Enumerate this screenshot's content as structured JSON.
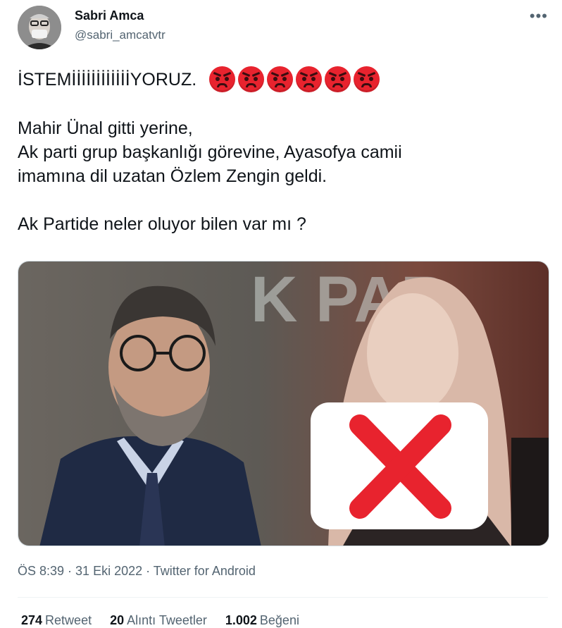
{
  "author": {
    "name": "Sabri Amca",
    "handle": "@sabri_amcatvtr"
  },
  "menu": {
    "icon": "more-icon",
    "glyph": "•••"
  },
  "tweet": {
    "line1": "İSTEMİİİİİİİİİİİİYORUZ.",
    "emoji_count": 6,
    "emoji_name": "angry-face-emoji",
    "line2": "Mahir Ünal gitti yerine,",
    "line3": "Ak parti grup başkanlığı görevine, Ayasofya camii",
    "line4": "imamına dil uzatan Özlem Zengin geldi.",
    "line5": "Ak Partide neler oluyor bilen var mı ?"
  },
  "media": {
    "sign_text": "K  PAR",
    "overlay_icon": "cross-mark-icon",
    "colors": {
      "background": "#5a5650",
      "accent": "#e8232e"
    }
  },
  "meta": {
    "time": "ÖS 8:39",
    "sep1": " · ",
    "date": "31 Eki 2022",
    "sep2": " · ",
    "source": "Twitter for Android"
  },
  "stats": {
    "retweets_count": "274",
    "retweets_label": "Retweet",
    "quotes_count": "20",
    "quotes_label": "Alıntı Tweetler",
    "likes_count": "1.002",
    "likes_label": "Beğeni"
  }
}
